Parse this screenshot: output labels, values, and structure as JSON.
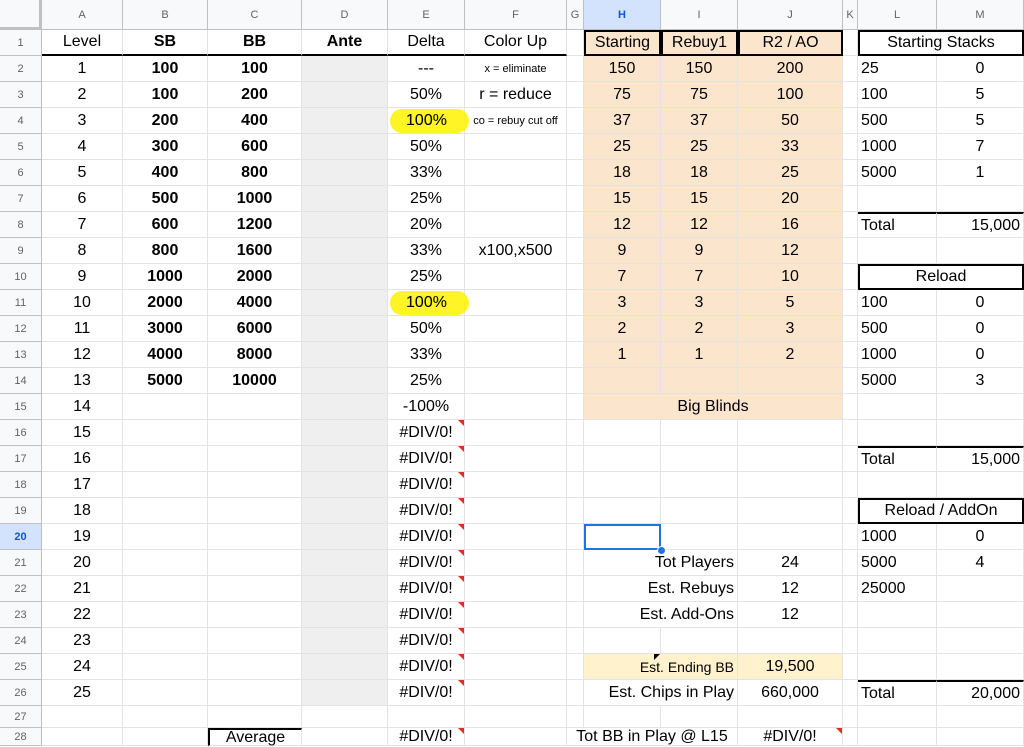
{
  "columns": [
    "A",
    "B",
    "C",
    "D",
    "E",
    "F",
    "G",
    "H",
    "I",
    "J",
    "K",
    "L",
    "M"
  ],
  "selected_column": "H",
  "selected_row": "20",
  "rows": [
    "1",
    "2",
    "3",
    "4",
    "5",
    "6",
    "7",
    "8",
    "9",
    "10",
    "11",
    "12",
    "13",
    "14",
    "15",
    "16",
    "17",
    "18",
    "19",
    "20",
    "21",
    "22",
    "23",
    "24",
    "25",
    "26",
    "27",
    "28"
  ],
  "header": {
    "A": "Level",
    "B": "SB",
    "C": "BB",
    "D": "Ante",
    "E": "Delta",
    "F": "Color Up",
    "H": "Starting",
    "I": "Rebuy1",
    "J": "R2 / AO",
    "L": "Starting Stacks"
  },
  "levels": [
    {
      "level": "1",
      "sb": "100",
      "bb": "100",
      "delta": "---",
      "color": "x = eliminate",
      "start": "150",
      "rebuy": "150",
      "r2": "200"
    },
    {
      "level": "2",
      "sb": "100",
      "bb": "200",
      "delta": "50%",
      "color": "r = reduce",
      "start": "75",
      "rebuy": "75",
      "r2": "100"
    },
    {
      "level": "3",
      "sb": "200",
      "bb": "400",
      "delta": "100%",
      "color": "co = rebuy cut off",
      "start": "37",
      "rebuy": "37",
      "r2": "50"
    },
    {
      "level": "4",
      "sb": "300",
      "bb": "600",
      "delta": "50%",
      "color": "",
      "start": "25",
      "rebuy": "25",
      "r2": "33"
    },
    {
      "level": "5",
      "sb": "400",
      "bb": "800",
      "delta": "33%",
      "color": "",
      "start": "18",
      "rebuy": "18",
      "r2": "25"
    },
    {
      "level": "6",
      "sb": "500",
      "bb": "1000",
      "delta": "25%",
      "color": "",
      "start": "15",
      "rebuy": "15",
      "r2": "20"
    },
    {
      "level": "7",
      "sb": "600",
      "bb": "1200",
      "delta": "20%",
      "color": "",
      "start": "12",
      "rebuy": "12",
      "r2": "16"
    },
    {
      "level": "8",
      "sb": "800",
      "bb": "1600",
      "delta": "33%",
      "color": "x100,x500",
      "start": "9",
      "rebuy": "9",
      "r2": "12"
    },
    {
      "level": "9",
      "sb": "1000",
      "bb": "2000",
      "delta": "25%",
      "color": "",
      "start": "7",
      "rebuy": "7",
      "r2": "10"
    },
    {
      "level": "10",
      "sb": "2000",
      "bb": "4000",
      "delta": "100%",
      "color": "",
      "start": "3",
      "rebuy": "3",
      "r2": "5"
    },
    {
      "level": "11",
      "sb": "3000",
      "bb": "6000",
      "delta": "50%",
      "color": "",
      "start": "2",
      "rebuy": "2",
      "r2": "3"
    },
    {
      "level": "12",
      "sb": "4000",
      "bb": "8000",
      "delta": "33%",
      "color": "",
      "start": "1",
      "rebuy": "1",
      "r2": "2"
    },
    {
      "level": "13",
      "sb": "5000",
      "bb": "10000",
      "delta": "25%",
      "color": "",
      "start": "",
      "rebuy": "",
      "r2": ""
    },
    {
      "level": "14",
      "sb": "",
      "bb": "",
      "delta": "-100%",
      "color": "",
      "start": "",
      "rebuy": "",
      "r2": ""
    },
    {
      "level": "15",
      "sb": "",
      "bb": "",
      "delta": "#DIV/0!",
      "color": "",
      "start": "",
      "rebuy": "",
      "r2": ""
    },
    {
      "level": "16",
      "sb": "",
      "bb": "",
      "delta": "#DIV/0!",
      "color": "",
      "start": "",
      "rebuy": "",
      "r2": ""
    },
    {
      "level": "17",
      "sb": "",
      "bb": "",
      "delta": "#DIV/0!",
      "color": "",
      "start": "",
      "rebuy": "",
      "r2": ""
    },
    {
      "level": "18",
      "sb": "",
      "bb": "",
      "delta": "#DIV/0!",
      "color": "",
      "start": "",
      "rebuy": "",
      "r2": ""
    },
    {
      "level": "19",
      "sb": "",
      "bb": "",
      "delta": "#DIV/0!",
      "color": "",
      "start": "",
      "rebuy": "",
      "r2": ""
    },
    {
      "level": "20",
      "sb": "",
      "bb": "",
      "delta": "#DIV/0!",
      "color": "",
      "start": "",
      "rebuy": "",
      "r2": ""
    },
    {
      "level": "21",
      "sb": "",
      "bb": "",
      "delta": "#DIV/0!",
      "color": "",
      "start": "",
      "rebuy": "",
      "r2": ""
    },
    {
      "level": "22",
      "sb": "",
      "bb": "",
      "delta": "#DIV/0!",
      "color": "",
      "start": "",
      "rebuy": "",
      "r2": ""
    },
    {
      "level": "23",
      "sb": "",
      "bb": "",
      "delta": "#DIV/0!",
      "color": "",
      "start": "",
      "rebuy": "",
      "r2": ""
    },
    {
      "level": "24",
      "sb": "",
      "bb": "",
      "delta": "#DIV/0!",
      "color": "",
      "start": "",
      "rebuy": "",
      "r2": ""
    },
    {
      "level": "25",
      "sb": "",
      "bb": "",
      "delta": "#DIV/0!",
      "color": "",
      "start": "",
      "rebuy": "",
      "r2": ""
    }
  ],
  "big_blinds_label": "Big Blinds",
  "starting_stacks": [
    [
      "25",
      "0"
    ],
    [
      "100",
      "5"
    ],
    [
      "500",
      "5"
    ],
    [
      "1000",
      "7"
    ],
    [
      "5000",
      "1"
    ]
  ],
  "starting_total": {
    "label": "Total",
    "value": "15,000"
  },
  "reload_title": "Reload",
  "reload": [
    [
      "100",
      "0"
    ],
    [
      "500",
      "0"
    ],
    [
      "1000",
      "0"
    ],
    [
      "5000",
      "3"
    ]
  ],
  "reload_total": {
    "label": "Total",
    "value": "15,000"
  },
  "reload_addon_title": "Reload / AddOn",
  "reload_addon": [
    [
      "1000",
      "0"
    ],
    [
      "5000",
      "4"
    ],
    [
      "25000",
      ""
    ]
  ],
  "addon_total": {
    "label": "Total",
    "value": "20,000"
  },
  "stats": {
    "tot_players_label": "Tot Players",
    "tot_players": "24",
    "est_rebuys_label": "Est. Rebuys",
    "est_rebuys": "12",
    "est_addons_label": "Est. Add-Ons",
    "est_addons": "12",
    "est_ending_bb_label": "Est. Ending BB",
    "est_ending_bb": "19,500",
    "est_chips_label": "Est. Chips in Play",
    "est_chips": "660,000"
  },
  "row28": {
    "average_label": "Average",
    "delta": "#DIV/0!",
    "tot_bb_label": "Tot BB in Play @ L15",
    "tot_bb": "#DIV/0!"
  },
  "colors": {
    "peach": "#fce5cd",
    "light_yellow": "#fff2cc",
    "highlight": "#fef200",
    "selection": "#1a73e8",
    "error_flag": "#d93025"
  }
}
